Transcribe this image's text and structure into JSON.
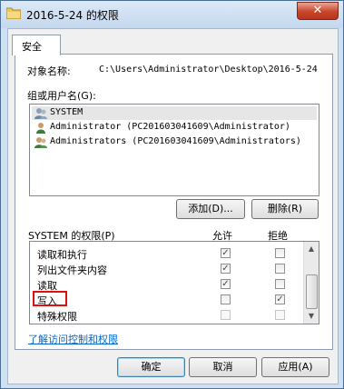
{
  "window": {
    "title": "2016-5-24 的权限",
    "close_glyph": "✕"
  },
  "tabs": [
    {
      "label": "安全"
    }
  ],
  "object": {
    "label": "对象名称:",
    "value": "C:\\Users\\Administrator\\Desktop\\2016-5-24"
  },
  "groups": {
    "label": "组或用户名(G):",
    "items": [
      {
        "name": "SYSTEM",
        "selected": true
      },
      {
        "name": "Administrator (PC201603041609\\Administrator)",
        "selected": false
      },
      {
        "name": "Administrators (PC201603041609\\Administrators)",
        "selected": false
      }
    ]
  },
  "actions": {
    "add_label": "添加(D)...",
    "remove_label": "删除(R)"
  },
  "permissions": {
    "label": "SYSTEM 的权限(P)",
    "allow_header": "允许",
    "deny_header": "拒绝",
    "rows": [
      {
        "name": "读取和执行",
        "allow": true,
        "deny": false,
        "dim": false
      },
      {
        "name": "列出文件夹内容",
        "allow": true,
        "deny": false,
        "dim": false
      },
      {
        "name": "读取",
        "allow": true,
        "deny": false,
        "dim": false
      },
      {
        "name": "写入",
        "allow": false,
        "deny": true,
        "dim": false
      },
      {
        "name": "特殊权限",
        "allow": false,
        "deny": false,
        "dim": true
      }
    ]
  },
  "help_link": "了解访问控制和权限",
  "buttons": {
    "ok": "确定",
    "cancel": "取消",
    "apply": "应用(A)"
  },
  "colors": {
    "highlight": "#e01010",
    "link": "#0066cc",
    "titlebar": "#c4d8ee"
  }
}
